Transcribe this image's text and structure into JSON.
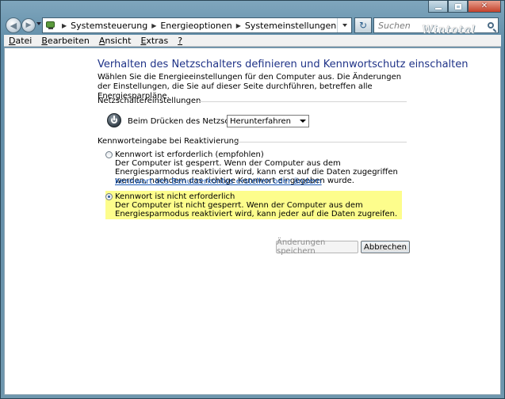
{
  "window": {
    "controls": {
      "minimize": "minimize",
      "maximize": "maximize",
      "close": "✕"
    },
    "watermark": "Wintotal"
  },
  "address": {
    "breadcrumbs": [
      "Systemsteuerung",
      "Energieoptionen",
      "Systemeinstellungen"
    ],
    "search_placeholder": "Suchen"
  },
  "menu": {
    "items": [
      {
        "accel": "D",
        "rest": "atei"
      },
      {
        "accel": "B",
        "rest": "earbeiten"
      },
      {
        "accel": "A",
        "rest": "nsicht"
      },
      {
        "accel": "E",
        "rest": "xtras"
      },
      {
        "accel": "?",
        "rest": ""
      }
    ]
  },
  "content": {
    "heading": "Verhalten des Netzschalters definieren und Kennwortschutz einschalten",
    "intro": "Wählen Sie die Energieeinstellungen für den Computer aus. Die Änderungen der Einstellungen, die Sie auf dieser Seite durchführen, betreffen alle Energiesparpläne.",
    "power_group": {
      "label": "Netzschaltereinstellungen",
      "setting_label": "Beim Drücken des Netzschalters:",
      "selected_value": "Herunterfahren"
    },
    "password_group": {
      "label": "Kennworteingabe bei Reaktivierung",
      "option_required": {
        "title": "Kennwort ist erforderlich (empfohlen)",
        "description": "Der Computer ist gesperrt. Wenn der Computer aus dem Energiesparmodus reaktiviert wird, kann erst auf die Daten zugegriffen werden, nachdem das richtige Kennwort eingegeben wurde.",
        "link": "Kennwort des Benutzerkontos erstellen oder ändern"
      },
      "option_not_required": {
        "title": "Kennwort ist nicht erforderlich",
        "description": "Der Computer ist nicht gesperrt. Wenn der Computer aus dem Energiesparmodus reaktiviert wird, kann jeder auf die Daten zugreifen."
      }
    },
    "buttons": {
      "save": "Änderungen speichern",
      "cancel": "Abbrechen"
    }
  }
}
